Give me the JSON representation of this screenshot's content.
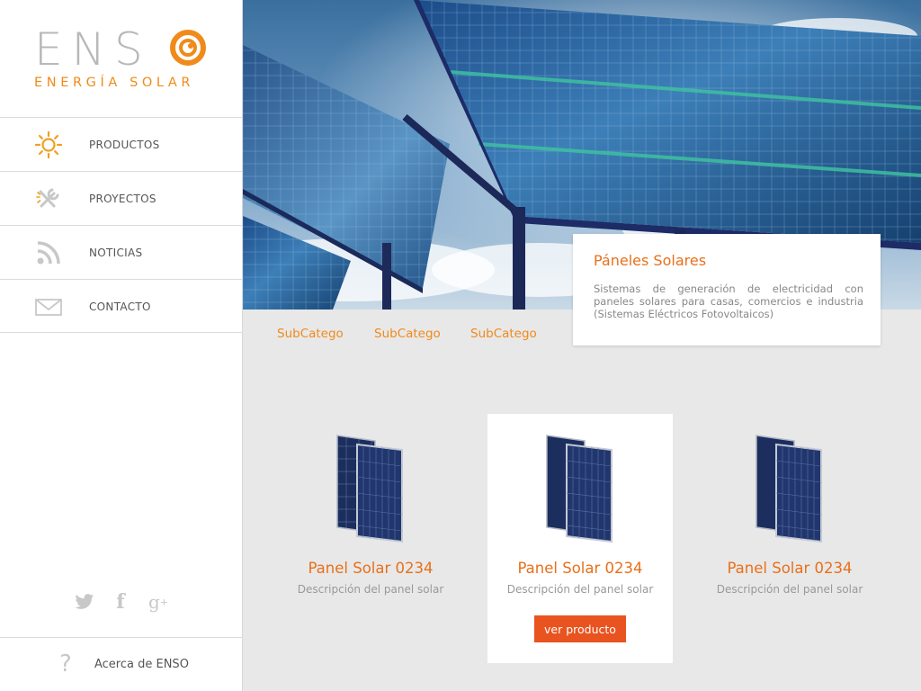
{
  "brand": {
    "logo_word": "ENS",
    "logo_tagline": "ENERGÍA SOLAR",
    "accent_color": "#f08a1a"
  },
  "nav": {
    "items": [
      {
        "label": "PRODUCTOS",
        "icon": "sun-icon"
      },
      {
        "label": "PROYECTOS",
        "icon": "tools-icon"
      },
      {
        "label": "NOTICIAS",
        "icon": "rss-icon"
      },
      {
        "label": "CONTACTO",
        "icon": "mail-icon"
      }
    ]
  },
  "social": {
    "icons": [
      "twitter-icon",
      "facebook-icon",
      "google-plus-icon"
    ]
  },
  "about": {
    "label": "Acerca de ENSO",
    "icon": "question-icon"
  },
  "hero": {
    "title": "Páneles Solares",
    "description": "Sistemas de generación de electricidad con paneles solares para casas, comercios e industria (Sistemas Eléctricos Fotovoltaicos)"
  },
  "subcategories": [
    "SubCatego",
    "SubCatego",
    "SubCatego"
  ],
  "products": [
    {
      "name": "Panel Solar 0234",
      "description": "Descripción del panel solar",
      "active": false
    },
    {
      "name": "Panel Solar 0234",
      "description": "Descripción del panel solar",
      "active": true,
      "button_label": "ver producto"
    },
    {
      "name": "Panel Solar 0234",
      "description": "Descripción del panel solar",
      "active": false
    }
  ]
}
